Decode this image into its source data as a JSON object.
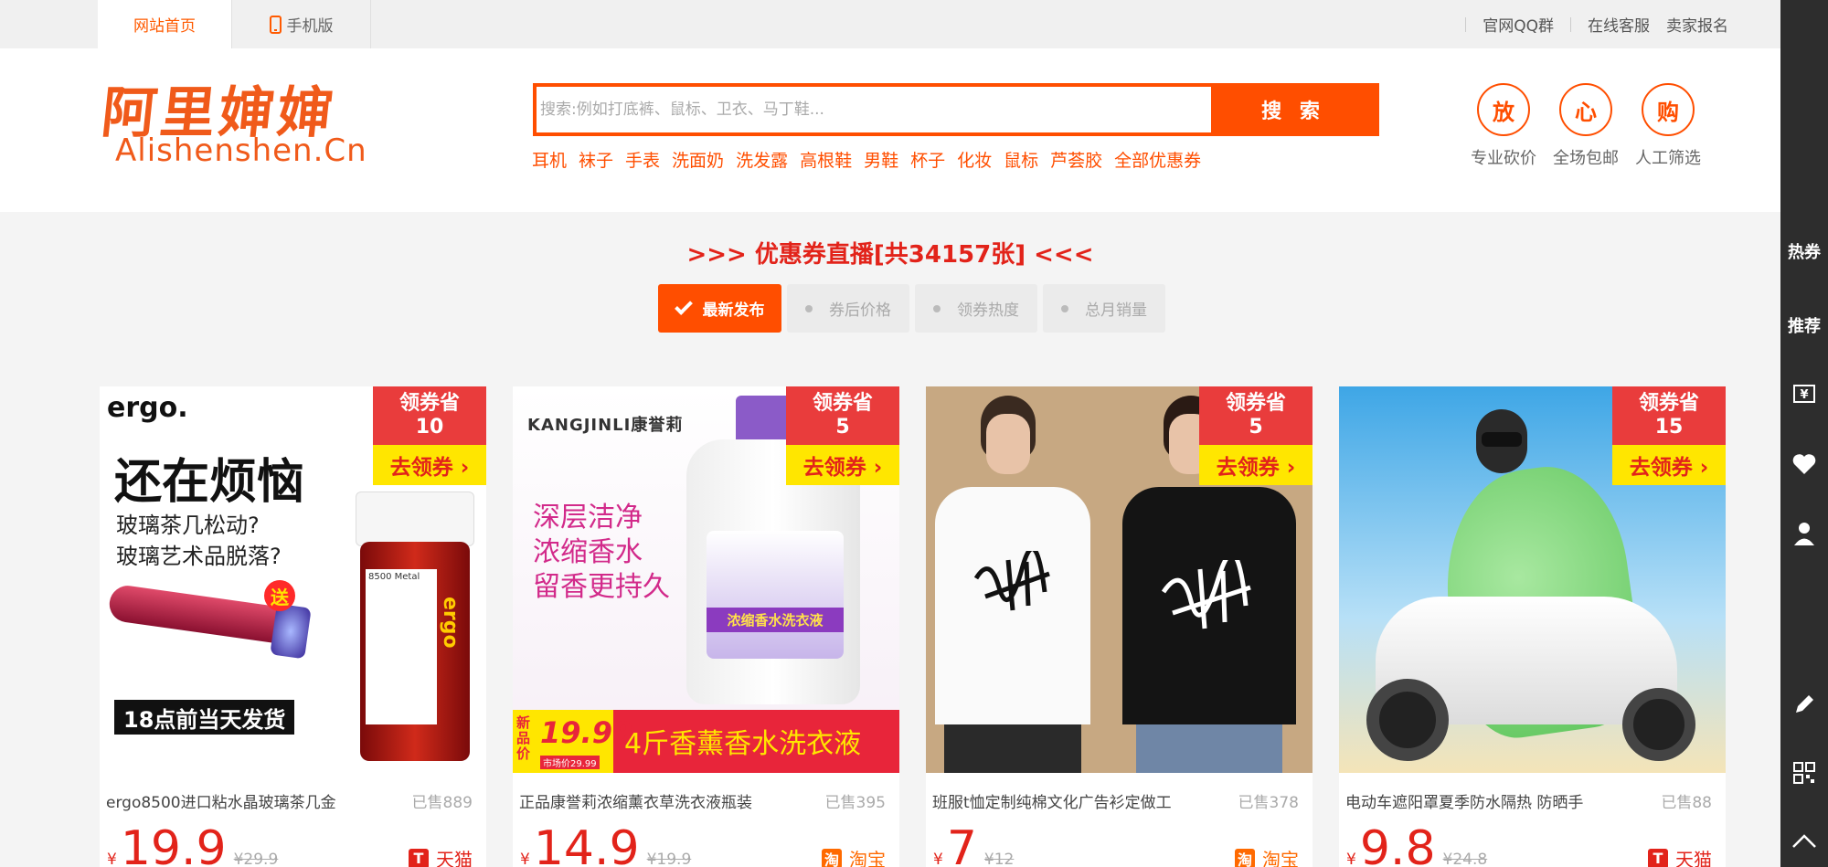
{
  "topbar": {
    "home_tab": "网站首页",
    "mobile_tab": "手机版",
    "links": [
      "官网QQ群",
      "在线客服",
      "卖家报名"
    ]
  },
  "header": {
    "logo_cn": "阿里婶婶",
    "logo_en": "Alishenshen.Cn",
    "search": {
      "placeholder": "搜索:例如打底裤、鼠标、卫衣、马丁鞋...",
      "button": "搜 索"
    },
    "hotwords": [
      "耳机",
      "袜子",
      "手表",
      "洗面奶",
      "洗发露",
      "高根鞋",
      "男鞋",
      "杯子",
      "化妆",
      "鼠标",
      "芦荟胶",
      "全部优惠券"
    ],
    "promises": [
      {
        "char": "放",
        "label": "专业砍价"
      },
      {
        "char": "心",
        "label": "全场包邮"
      },
      {
        "char": "购",
        "label": "人工筛选"
      }
    ]
  },
  "live_title": ">>> 优惠券直播[共34157张] <<<",
  "sort_tabs": [
    "最新发布",
    "券后价格",
    "领券热度",
    "总月销量"
  ],
  "coupon_badge": {
    "save_label": "领券省",
    "get_label": "去领券 ›"
  },
  "products": [
    {
      "title": "ergo8500进口粘水晶玻璃茶几金",
      "sold": "已售889",
      "yen": "¥",
      "price": "19.9",
      "old_price": "¥29.9",
      "coupon": "10",
      "shop": "天猫",
      "shop_icon": "T",
      "art": {
        "brand": "ergo.",
        "headline": "还在烦恼",
        "lines": [
          "玻璃茶几松动?",
          "玻璃艺术品脱落?"
        ],
        "send": "送",
        "ship": "18点前当天发货",
        "bottle_label": "ergo",
        "bottle_code": "8500 Metal"
      }
    },
    {
      "title": "正品康誉莉浓缩薰衣草洗衣液瓶装",
      "sold": "已售395",
      "yen": "¥",
      "price": "14.9",
      "old_price": "¥19.9",
      "coupon": "5",
      "shop": "淘宝",
      "shop_icon": "淘",
      "art": {
        "brand": "KANGJINLI康誉莉",
        "lines": [
          "深层洁净",
          "浓缩香水",
          "留香更持久"
        ],
        "promo_price": "19.99",
        "promo_label": "新品价",
        "market": "市场价29.99",
        "banner": "4斤香薰香水洗衣液",
        "bottle_label": "浓缩香水洗衣液"
      }
    },
    {
      "title": "班服t恤定制纯棉文化广告衫定做工",
      "sold": "已售378",
      "yen": "¥",
      "price": "7",
      "old_price": "¥12",
      "coupon": "5",
      "shop": "淘宝",
      "shop_icon": "淘",
      "art": {}
    },
    {
      "title": "电动车遮阳罩夏季防水隔热 防晒手",
      "sold": "已售88",
      "yen": "¥",
      "price": "9.8",
      "old_price": "¥24.8",
      "coupon": "15",
      "shop": "天猫",
      "shop_icon": "T",
      "art": {}
    }
  ],
  "right_sidebar": {
    "hot": "热券",
    "recommend": "推荐",
    "icons": [
      "coupon-icon",
      "heart-icon",
      "user-icon",
      "edit-icon",
      "qrcode-icon",
      "back-to-top-icon"
    ]
  },
  "colors": {
    "accent": "#ff4e00",
    "red": "#e2231a",
    "badge_red": "#e93c3c",
    "badge_yellow": "#ffe600",
    "sidebar": "#2d2d2d"
  }
}
